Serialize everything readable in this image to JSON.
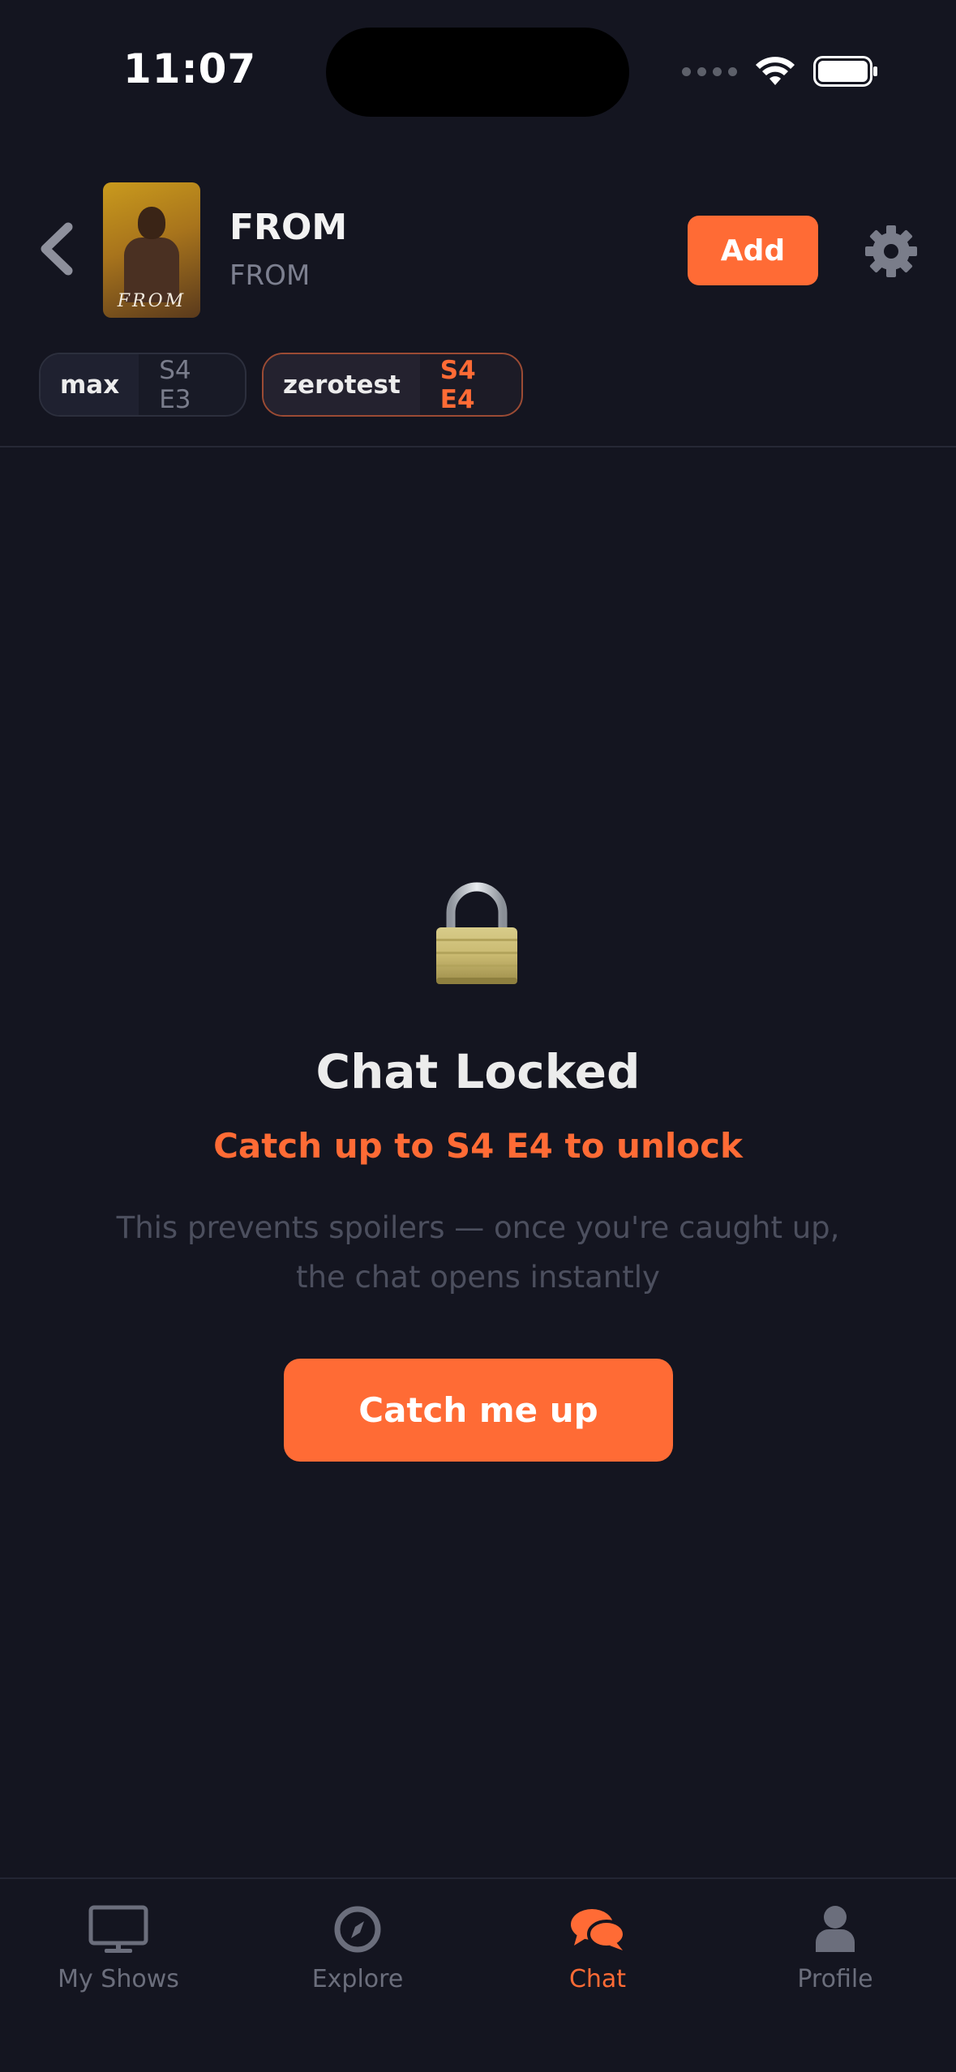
{
  "status_bar": {
    "time": "11:07"
  },
  "header": {
    "show_title": "FROM",
    "show_subtitle": "FROM",
    "poster_text": "FROM",
    "add_label": "Add"
  },
  "participants": [
    {
      "name": "max",
      "episode": "S4 E3"
    },
    {
      "name": "zerotest",
      "episode": "S4 E4"
    }
  ],
  "locked": {
    "title": "Chat Locked",
    "subtitle": "Catch up to S4 E4 to unlock",
    "description": "This prevents spoilers — once you're caught up, the chat opens instantly",
    "button_label": "Catch me up"
  },
  "tabs": [
    {
      "label": "My Shows",
      "icon": "tv-icon",
      "active": false
    },
    {
      "label": "Explore",
      "icon": "compass-icon",
      "active": false
    },
    {
      "label": "Chat",
      "icon": "chat-bubbles-icon",
      "active": true
    },
    {
      "label": "Profile",
      "icon": "person-icon",
      "active": false
    }
  ],
  "colors": {
    "background": "#141520",
    "accent": "#ff6b35",
    "muted_text": "#6b6e7c"
  }
}
